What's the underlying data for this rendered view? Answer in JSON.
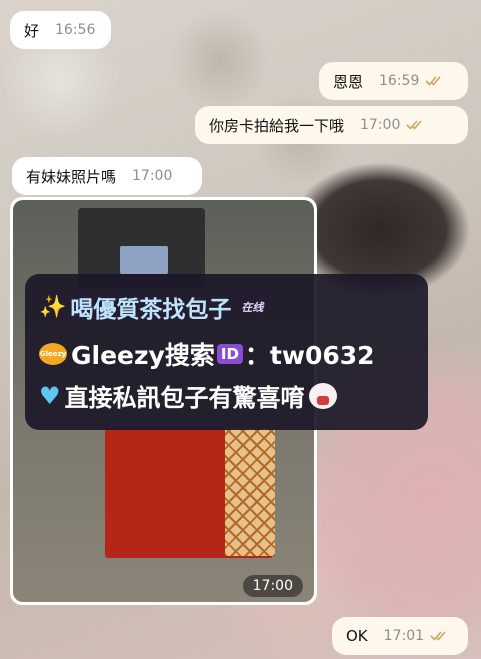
{
  "colors": {
    "bubble_in": "#ffffff",
    "bubble_out": "#fdf7ec",
    "read_ticks": "#c8a860",
    "promo_bg": "#1c1828"
  },
  "messages": [
    {
      "direction": "incoming",
      "text": "好",
      "time": "16:56"
    },
    {
      "direction": "outgoing",
      "text": "恩恩",
      "time": "16:59",
      "status": "read"
    },
    {
      "direction": "outgoing",
      "text": "你房卡拍給我一下哦",
      "time": "17:00",
      "status": "read"
    },
    {
      "direction": "incoming",
      "text": "有妹妹照片嗎",
      "time": "17:00"
    },
    {
      "direction": "incoming",
      "type": "image",
      "time": "17:00"
    },
    {
      "direction": "outgoing",
      "text": "OK",
      "time": "17:01",
      "status": "read"
    }
  ],
  "promo": {
    "line1": "喝優質茶找包子",
    "line1_tag": "在线",
    "gleezy_badge": "Gleezy",
    "line2_prefix": "Gleezy搜索",
    "line2_id": "ID",
    "line2_suffix": "：tw0632",
    "line3": "直接私訊包子有驚喜唷"
  },
  "icons": {
    "read_status": "double-check-icon",
    "sparkle": "sparkles-icon",
    "heart": "blue-heart-icon",
    "face": "cat-face-icon"
  }
}
